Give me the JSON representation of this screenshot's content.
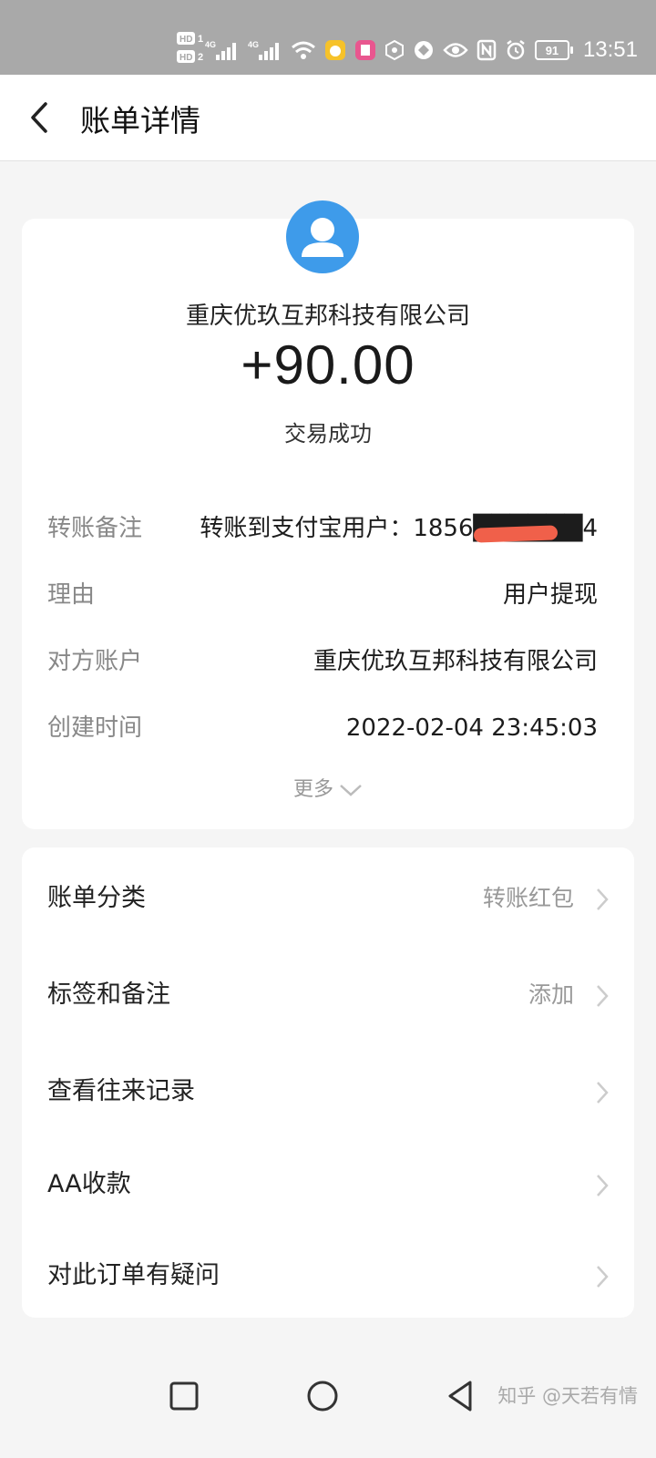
{
  "status_bar": {
    "time": "13:51",
    "battery": "91",
    "icons": [
      "hd-icon",
      "signal-4g-icon",
      "signal-4g-icon",
      "wifi-icon",
      "app-icon",
      "app-icon",
      "hexagon-icon",
      "circle-icon",
      "eye-icon",
      "nfc-icon",
      "alarm-icon",
      "battery-icon"
    ]
  },
  "header": {
    "title": "账单详情"
  },
  "transaction": {
    "company": "重庆优玖互邦科技有限公司",
    "amount": "+90.00",
    "status": "交易成功"
  },
  "details": [
    {
      "label": "转账备注",
      "value": "转账到支付宝用户：1856██████4"
    },
    {
      "label": "理由",
      "value": "用户提现"
    },
    {
      "label": "对方账户",
      "value": "重庆优玖互邦科技有限公司"
    },
    {
      "label": "创建时间",
      "value": "2022-02-04 23:45:03"
    }
  ],
  "more_label": "更多",
  "menu": [
    {
      "label": "账单分类",
      "value": "转账红包"
    },
    {
      "label": "标签和备注",
      "value": "添加"
    },
    {
      "label": "查看往来记录",
      "value": ""
    },
    {
      "label": "AA收款",
      "value": ""
    },
    {
      "label": "对此订单有疑问",
      "value": ""
    }
  ],
  "watermark": "知乎 @天若有情",
  "colors": {
    "avatar_blue": "#3e9bea",
    "status_bar_bg": "#a9a9a9",
    "redact_red": "#f0604a"
  }
}
